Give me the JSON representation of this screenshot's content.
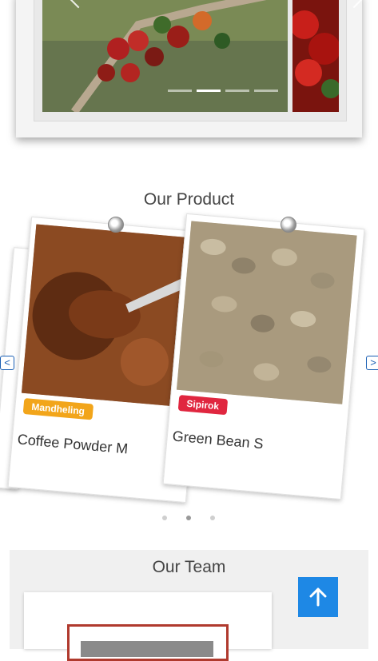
{
  "hero": {
    "slides": [
      "coffee-cherries-branch",
      "red-coffee-cherries"
    ],
    "active_indicator": 2,
    "indicator_count": 4
  },
  "product": {
    "title": "Our Product",
    "items": [
      {
        "name": "Coffee Powder M",
        "badge": "Mandheling",
        "badge_color": "#f2a51a",
        "icon": "coffee-powder-image"
      },
      {
        "name": "Green Bean S",
        "badge": "Sipirok",
        "badge_color": "#e0263f",
        "icon": "green-bean-image"
      }
    ],
    "prev_label": "<",
    "next_label": ">",
    "pagination_count": 3,
    "pagination_active": 2
  },
  "team": {
    "title": "Our Team"
  },
  "back_to_top": {
    "icon": "arrow-up-icon",
    "color": "#1e88e5"
  }
}
